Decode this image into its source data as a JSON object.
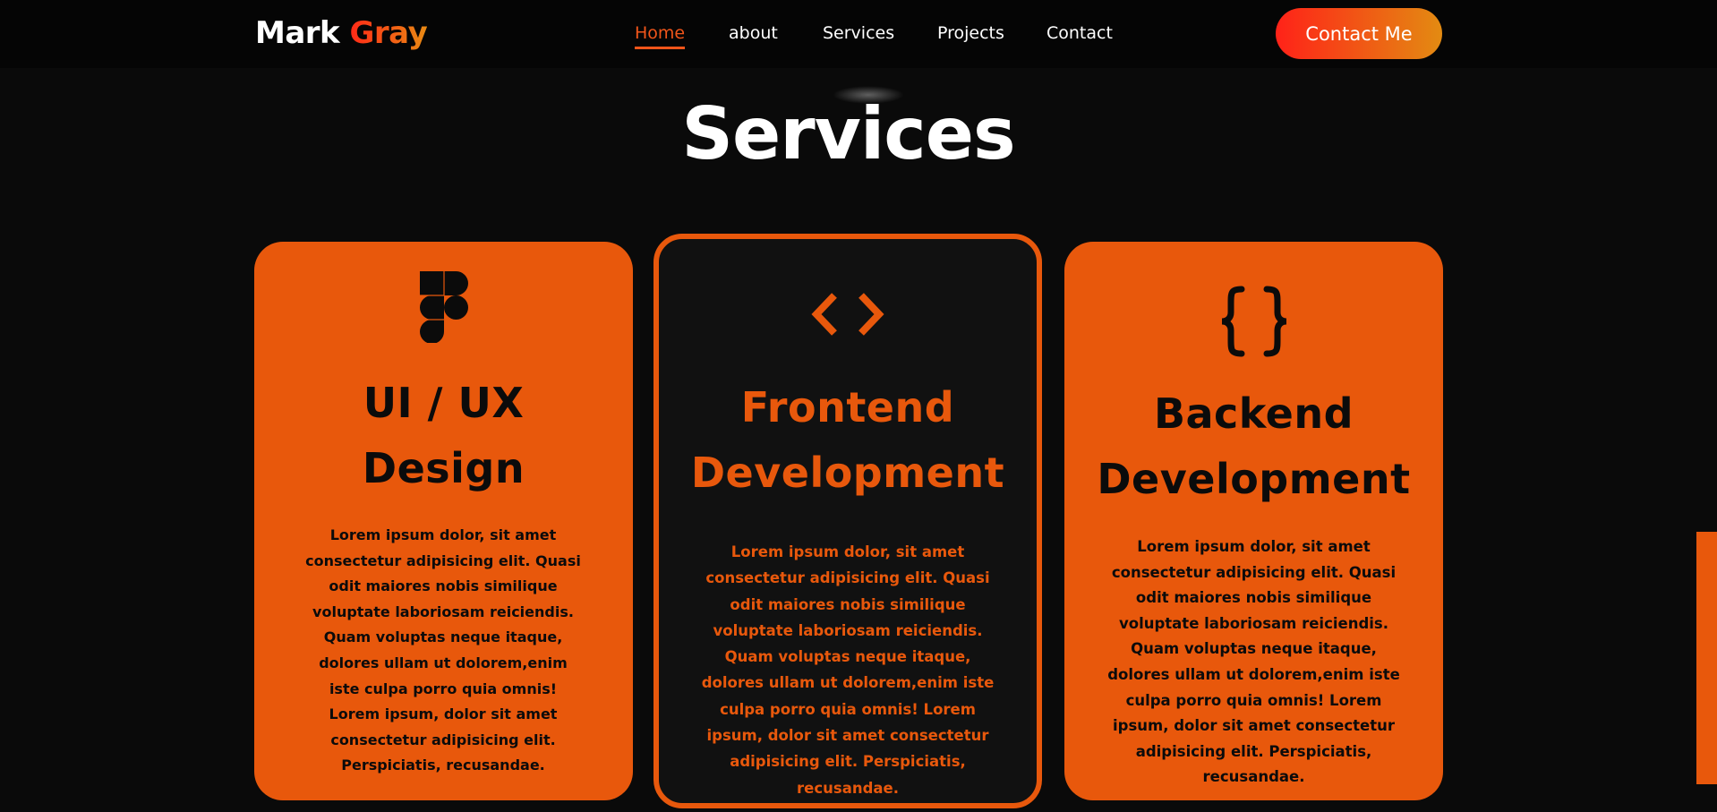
{
  "header": {
    "logo_first": "Mark",
    "logo_last": "Gray",
    "nav": [
      {
        "label": "Home",
        "active": true
      },
      {
        "label": "about",
        "active": false
      },
      {
        "label": "Services",
        "active": false
      },
      {
        "label": "Projects",
        "active": false
      },
      {
        "label": "Contact",
        "active": false
      }
    ],
    "cta_label": "Contact Me"
  },
  "section": {
    "title": "Services"
  },
  "cards": [
    {
      "icon": "figma-icon",
      "title_line1": "UI / UX",
      "title_line2": "Design",
      "body": "Lorem ipsum dolor, sit amet consectetur adipisicing elit. Quasi odit maiores nobis similique voluptate laboriosam reiciendis. Quam voluptas neque itaque, dolores ullam ut dolorem,enim iste culpa porro quia omnis! Lorem ipsum, dolor sit amet consectetur adipisicing elit. Perspiciatis, recusandae."
    },
    {
      "icon": "code-brackets-icon",
      "title_line1": "Frontend",
      "title_line2": "Development",
      "body": "Lorem ipsum dolor, sit amet consectetur adipisicing elit. Quasi odit maiores nobis similique voluptate laboriosam reiciendis. Quam voluptas neque itaque, dolores ullam ut dolorem,enim iste culpa porro quia omnis! Lorem ipsum, dolor sit amet consectetur adipisicing elit. Perspiciatis, recusandae."
    },
    {
      "icon": "curly-braces-icon",
      "title_line1": "Backend",
      "title_line2": "Development",
      "body": "Lorem ipsum dolor, sit amet consectetur adipisicing elit. Quasi odit maiores nobis similique voluptate laboriosam reiciendis. Quam voluptas neque itaque, dolores ullam ut dolorem,enim iste culpa porro quia omnis! Lorem ipsum, dolor sit amet consectetur adipisicing elit. Perspiciatis, recusandae."
    }
  ],
  "colors": {
    "accent": "#e8580c",
    "background": "#0a0a0a",
    "gradient_start": "#ff2218",
    "gradient_end": "#e38b12"
  }
}
